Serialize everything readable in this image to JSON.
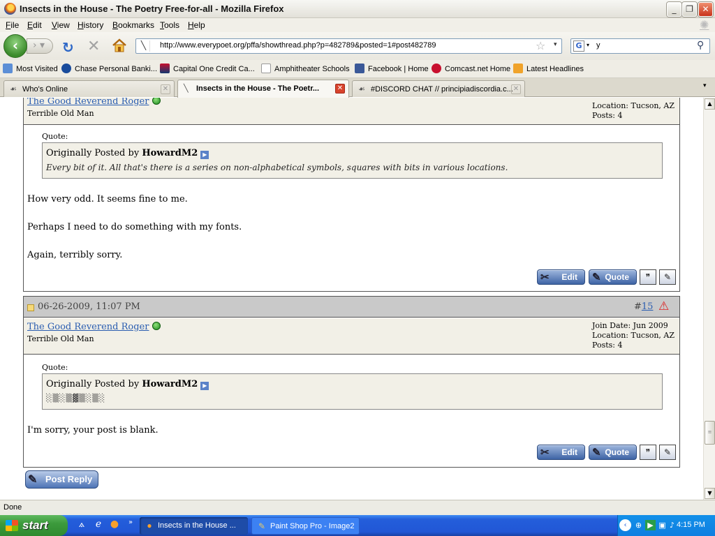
{
  "window": {
    "title": "Insects in the House - The Poetry Free-for-all - Mozilla Firefox"
  },
  "menu": [
    "File",
    "Edit",
    "View",
    "History",
    "Bookmarks",
    "Tools",
    "Help"
  ],
  "nav": {
    "url": "http://www.everypoet.org/pffa/showthread.php?p=482789&posted=1#post482789",
    "search_value": "y"
  },
  "bookmarks": [
    "Most Visited",
    "Chase Personal Banki...",
    "Capital One Credit Ca...",
    "Amphitheater Schools",
    "Facebook | Home",
    "Comcast.net Home",
    "Latest Headlines"
  ],
  "tabs": [
    "Who's Online",
    "Insects in the House - The Poetr...",
    "#DISCORD CHAT // principiadiscordia.c..."
  ],
  "post1": {
    "username": "The Good Reverend Roger",
    "user_title": "Terrible Old Man",
    "location": "Location: Tucson, AZ",
    "posts": "Posts: 4",
    "quote_label": "Quote:",
    "quote_prefix": "Originally Posted by",
    "quote_author": "HowardM2",
    "quote_text": "Every bit of it. All that's there is a series on non-alphabetical symbols, squares with bits in various locations.",
    "body": [
      "How very odd. It seems fine to me.",
      "Perhaps I need to do something with my fonts.",
      "Again, terribly sorry."
    ],
    "edit_label": "Edit",
    "quote_btn_label": "Quote"
  },
  "post2": {
    "date": "06-26-2009, 11:07 PM",
    "number_prefix": "#",
    "number": "15",
    "username": "The Good Reverend Roger",
    "user_title": "Terrible Old Man",
    "join_date": "Join Date: Jun 2009",
    "location": "Location: Tucson, AZ",
    "posts": "Posts: 4",
    "quote_label": "Quote:",
    "quote_prefix": "Originally Posted by",
    "quote_author": "HowardM2",
    "quote_text": "░▒░▒▓▒░▒░",
    "body": [
      "I'm sorry, your post is blank."
    ],
    "edit_label": "Edit",
    "quote_btn_label": "Quote"
  },
  "post_reply_label": "Post Reply",
  "status": "Done",
  "taskbar": {
    "start": "start",
    "tasks": [
      "Insects in the House ...",
      "Paint Shop Pro - Image2"
    ],
    "clock": "4:15 PM"
  },
  "colors": {
    "link": "#2a5db0",
    "userbar": "#f2f0e7",
    "datebar": "#c9c9c9",
    "taskbar": "#245edb",
    "start": "#3c9a3c"
  }
}
